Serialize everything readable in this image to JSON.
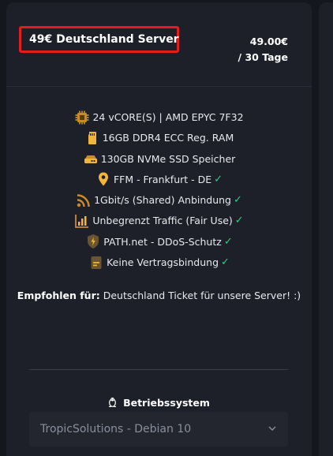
{
  "product": {
    "title": "49€ Deutschland Server",
    "price": "49.00€",
    "period": "/ 30 Tage"
  },
  "features": [
    {
      "icon": "cpu-icon",
      "text": "24 vCORE(S) | AMD EPYC 7F32",
      "check": ""
    },
    {
      "icon": "ram-icon",
      "text": "16GB DDR4 ECC Reg. RAM",
      "check": ""
    },
    {
      "icon": "ssd-icon",
      "text": "130GB NVMe SSD Speicher",
      "check": ""
    },
    {
      "icon": "location-pin-icon",
      "text": "FFM - Frankfurt - DE",
      "check": "✓"
    },
    {
      "icon": "rss-icon",
      "text": "1Gbit/s (Shared) Anbindung",
      "check": "✓"
    },
    {
      "icon": "traffic-chart-icon",
      "text": "Unbegrenzt Traffic (Fair Use)",
      "check": "✓"
    },
    {
      "icon": "shield-icon",
      "text": "PATH.net - DDoS-Schutz",
      "check": "✓"
    },
    {
      "icon": "document-icon",
      "text": "Keine Vertragsbindung",
      "check": "✓"
    }
  ],
  "recommend": {
    "label": "Empfohlen für:",
    "text": "Deutschland Ticket für unsere Server! :)"
  },
  "os": {
    "icon": "tux-icon",
    "label": "Betriebssystem",
    "selected": "TropicSolutions - Debian 10"
  },
  "colors": {
    "background": "#15171f",
    "card": "#1d2029",
    "highlight_border": "#e11d1d",
    "icon_accent": "#f2b53a",
    "check": "#2fce7e"
  }
}
